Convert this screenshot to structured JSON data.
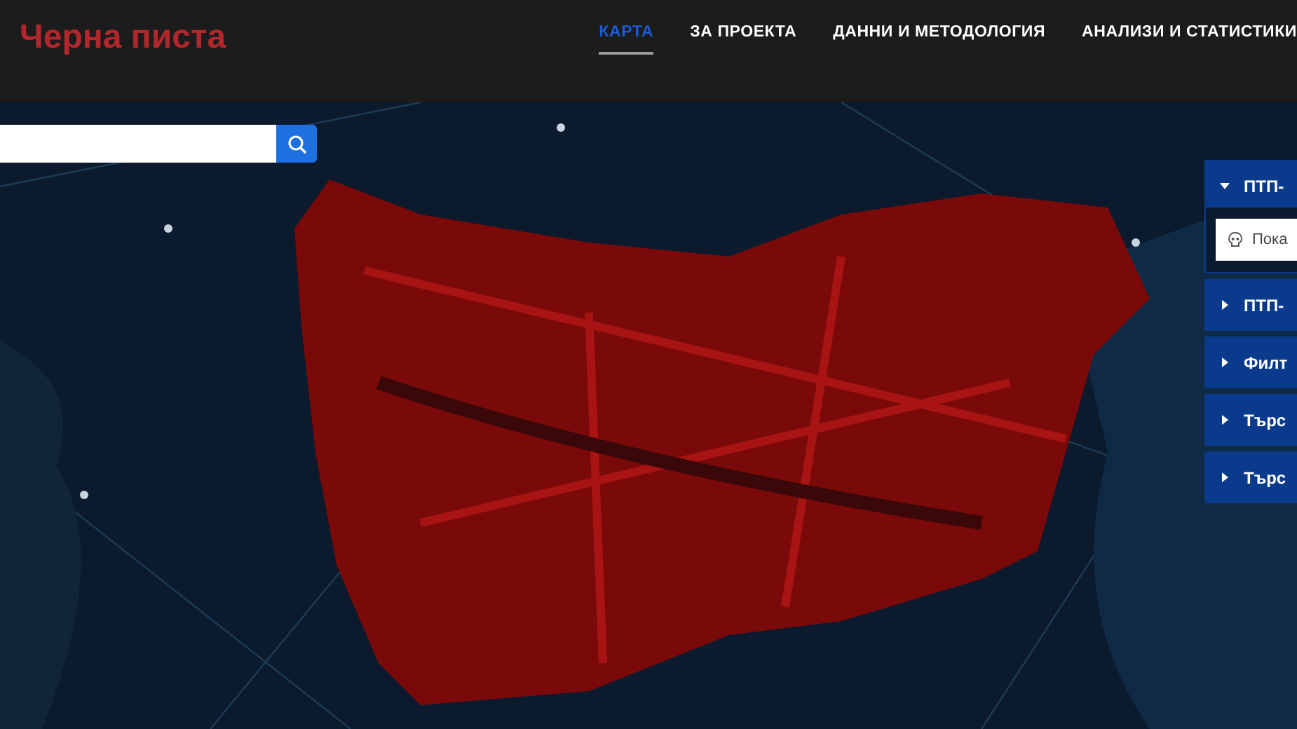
{
  "header": {
    "logo": "Черна писта",
    "nav": [
      {
        "label": "КАРТА",
        "selected": true
      },
      {
        "label": "ЗА ПРОЕКТА",
        "selected": false
      },
      {
        "label": "ДАННИ И МЕТОДОЛОГИЯ",
        "selected": false
      },
      {
        "label": "АНАЛИЗИ И СТАТИСТИКИ",
        "selected": false
      }
    ]
  },
  "panels": [
    {
      "title": "ПТП-",
      "expanded": true,
      "option": "Пока"
    },
    {
      "title": "ПТП-",
      "expanded": false
    },
    {
      "title": "Филт",
      "expanded": false
    },
    {
      "title": "Търс",
      "expanded": false
    },
    {
      "title": "Търс",
      "expanded": false
    }
  ]
}
